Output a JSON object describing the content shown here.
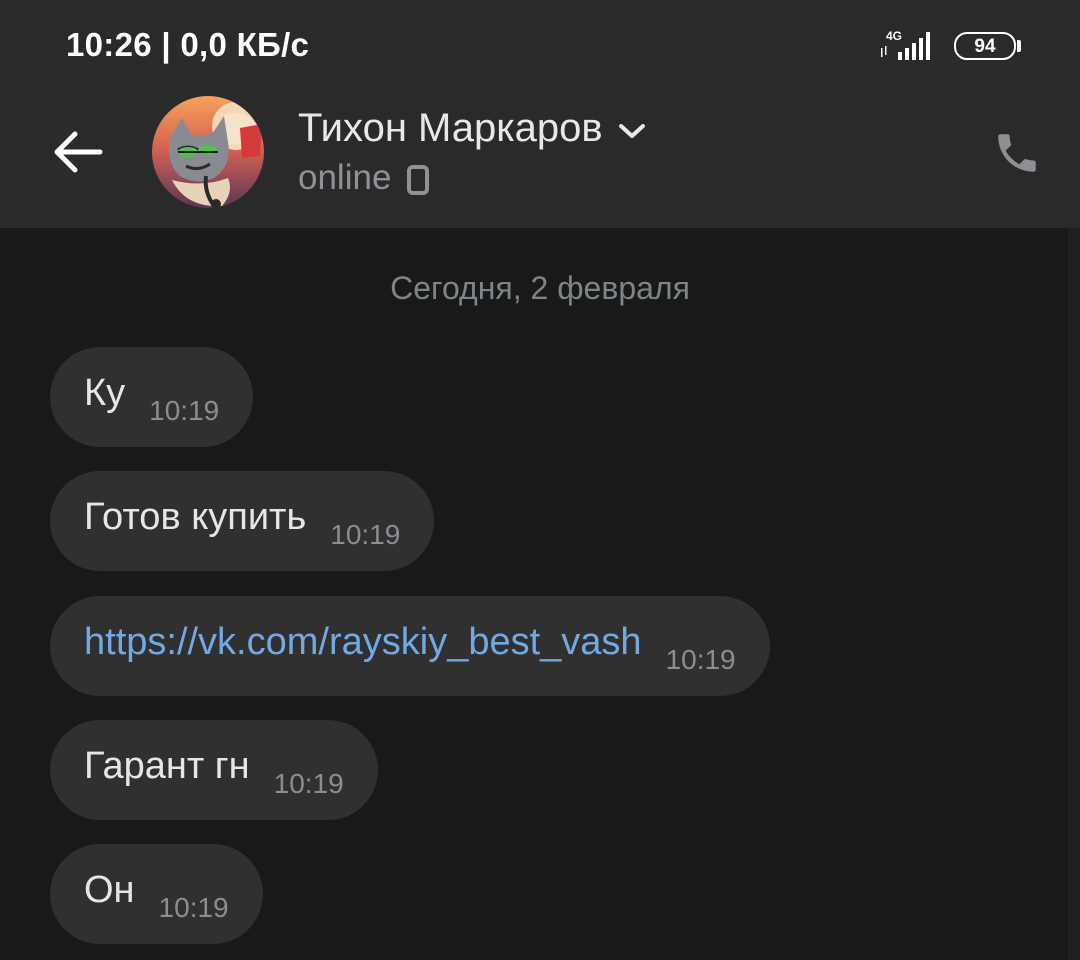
{
  "status_bar": {
    "time_speed": "10:26 | 0,0 КБ/с",
    "network_type": "4G",
    "battery_level": "94",
    "signal_icon": "signal-bars-icon"
  },
  "header": {
    "back_icon": "arrow-left-icon",
    "contact_name": "Тихон Маркаров",
    "contact_status": "online",
    "status_device_icon": "mobile-phone-icon",
    "call_icon": "phone-call-icon",
    "avatar_icon": "cartoon-cat-avatar"
  },
  "chat": {
    "date_separator": "Сегодня, 2 февраля",
    "messages": [
      {
        "text": "Ку",
        "time": "10:19",
        "is_link": false
      },
      {
        "text": "Готов купить",
        "time": "10:19",
        "is_link": false
      },
      {
        "text": "https://vk.com/rayskiy_best_vash",
        "time": "10:19",
        "is_link": true
      },
      {
        "text": "Гарант гн",
        "time": "10:19",
        "is_link": false
      },
      {
        "text": "Он",
        "time": "10:19",
        "is_link": false
      }
    ]
  },
  "colors": {
    "header_background": "#2a2a2b",
    "chat_background": "#191919",
    "bubble_background": "#303031",
    "link_color": "#71a9e4",
    "primary_text": "#e6e6e6",
    "secondary_text": "#8a8e92"
  }
}
